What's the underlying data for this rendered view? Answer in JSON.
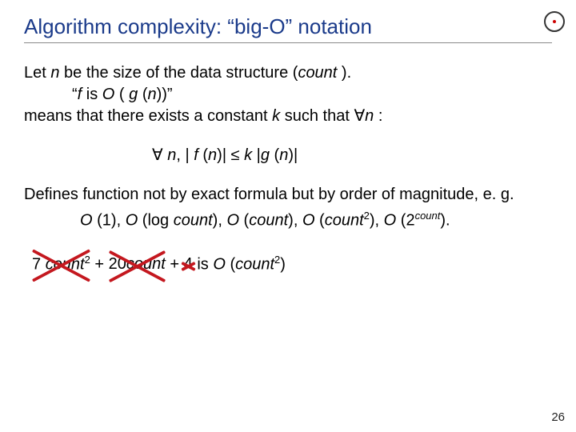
{
  "title": "Algorithm complexity: “big-O” notation",
  "line1_a": "Let ",
  "line1_n": "n",
  "line1_b": " be the size of the data structure (",
  "line1_count": "count",
  "line1_c": " ).",
  "line2_a": "“",
  "line2_f": "f",
  "line2_b": " is ",
  "line2_O": "O",
  "line2_c": " ( ",
  "line2_g": "g",
  "line2_d": " (",
  "line2_n": "n",
  "line2_e": "))”",
  "line3_a": "means that there exists a constant ",
  "line3_k": "k",
  "line3_b": " such that ",
  "line3_forall": "∀",
  "line3_n": "n",
  "line3_c": " :",
  "formula_a": "∀ ",
  "formula_n1": "n",
  "formula_b": ", | ",
  "formula_f": "f",
  "formula_c": " (",
  "formula_n2": "n",
  "formula_d": ")| ≤ ",
  "formula_k": "k",
  "formula_e": " |",
  "formula_g": "g",
  "formula_f2": " (",
  "formula_n3": "n",
  "formula_g2": ")|",
  "para2_a": "Defines function not by exact formula but by order of magnitude, e. g.",
  "list_a": "O",
  "list_b": " (1), ",
  "list_c": "O",
  "list_d": " (log ",
  "list_count1": "count",
  "list_e": "), ",
  "list_f": "O",
  "list_g": " (",
  "list_count2": "count",
  "list_h": "), ",
  "list_i": "O",
  "list_j": " (",
  "list_count3": "count",
  "list_sup1": "2",
  "list_k": "), ",
  "list_l": "O",
  "list_m": " (2",
  "list_sup2": "count",
  "list_n": ").",
  "ex_t1_a": "7 ",
  "ex_t1_count": "count",
  "ex_t1_sup": "2",
  "ex_plus1": " + ",
  "ex_t2_a": "20",
  "ex_t2_count": "count",
  "ex_plus2": " + ",
  "ex_t3": "4",
  "ex_is": "  is  ",
  "ex_O": "O",
  "ex_p1": " (",
  "ex_count": "count",
  "ex_sup": "2",
  "ex_p2": ")",
  "pagenum": "26"
}
